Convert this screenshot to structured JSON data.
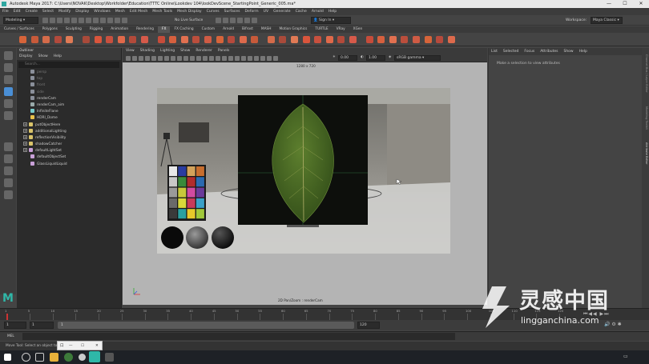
{
  "window": {
    "title": "Autodesk Maya 2017: C:\\Users\\NOVAK\\Desktop\\Workfolder\\Education\\TTTC Online\\Lookdev 104\\lookDevScene_StartingPoint_Generic_005.ma*",
    "controls": [
      "—",
      "☐",
      "✕"
    ]
  },
  "menubar": [
    "File",
    "Edit",
    "Create",
    "Select",
    "Modify",
    "Display",
    "Windows",
    "Mesh",
    "Edit Mesh",
    "Mesh Tools",
    "Mesh Display",
    "Curves",
    "Surfaces",
    "Deform",
    "UV",
    "Generate",
    "Cache",
    "Arnold",
    "Help"
  ],
  "statusline": {
    "mode": "Modeling",
    "live_surface": "No Live Surface",
    "sign_in": "Sign In",
    "workspace_label": "Workspace:",
    "workspace_value": "Maya Classic"
  },
  "shelf_tabs": [
    {
      "label": "Curves / Surfaces",
      "active": false
    },
    {
      "label": "Polygons",
      "active": false
    },
    {
      "label": "Sculpting",
      "active": false
    },
    {
      "label": "Rigging",
      "active": false
    },
    {
      "label": "Animation",
      "active": false
    },
    {
      "label": "Rendering",
      "active": false
    },
    {
      "label": "FX",
      "active": true
    },
    {
      "label": "FX Caching",
      "active": false
    },
    {
      "label": "Custom",
      "active": false
    },
    {
      "label": "Arnold",
      "active": false
    },
    {
      "label": "Bifrost",
      "active": false
    },
    {
      "label": "MASH",
      "active": false
    },
    {
      "label": "Motion Graphics",
      "active": false
    },
    {
      "label": "TURTLE",
      "active": false
    },
    {
      "label": "VRay",
      "active": false
    },
    {
      "label": "XGen",
      "active": false
    }
  ],
  "outliner": {
    "title": "Outliner",
    "menu": [
      "Display",
      "Show",
      "Help"
    ],
    "search_placeholder": "Search...",
    "items": [
      {
        "label": "persp",
        "dim": true,
        "icon": "camera-icon",
        "expander": false
      },
      {
        "label": "top",
        "dim": true,
        "icon": "camera-icon",
        "expander": false
      },
      {
        "label": "front",
        "dim": true,
        "icon": "camera-icon",
        "expander": false
      },
      {
        "label": "side",
        "dim": true,
        "icon": "camera-icon",
        "expander": false
      },
      {
        "label": "renderCam",
        "dim": false,
        "icon": "camera-icon",
        "expander": false
      },
      {
        "label": "renderCam_aim",
        "dim": false,
        "icon": "locator-icon",
        "expander": false
      },
      {
        "label": "InfiniteFlane",
        "dim": false,
        "icon": "mesh-icon",
        "expander": false
      },
      {
        "label": "HDRI_Dome",
        "dim": false,
        "icon": "light-icon",
        "expander": false
      },
      {
        "label": "putObjectHere",
        "dim": false,
        "icon": "group-icon",
        "expander": true
      },
      {
        "label": "additionalLighting",
        "dim": false,
        "icon": "group-icon",
        "expander": true
      },
      {
        "label": "reflectionVisibility",
        "dim": false,
        "icon": "group-icon",
        "expander": true
      },
      {
        "label": "shadowCatcher",
        "dim": false,
        "icon": "group-icon",
        "expander": true
      },
      {
        "label": "defaultLightSet",
        "dim": false,
        "icon": "set-icon",
        "expander": true
      },
      {
        "label": "defaultObjectSet",
        "dim": false,
        "icon": "set-icon",
        "expander": false
      },
      {
        "label": "GlassLiquidLiquid",
        "dim": false,
        "icon": "set-icon",
        "expander": false
      }
    ]
  },
  "viewport": {
    "menu": [
      "View",
      "Shading",
      "Lighting",
      "Show",
      "Renderer",
      "Panels"
    ],
    "exposure": "0.00",
    "gamma": "1.00",
    "color_space": "sRGB gamma",
    "resolution_hud": "1280 x 720",
    "camera_hud": "2D Pan/Zoom : renderCam"
  },
  "attribute_editor": {
    "menu": [
      "List",
      "Selected",
      "Focus",
      "Attributes",
      "Show",
      "Help"
    ],
    "message": "Make a selection to view attributes"
  },
  "side_tabs": [
    "Channel Box / Layer Editor",
    "Modeling Toolkit",
    "Attribute Editor"
  ],
  "timeline": {
    "ticks": [
      "1",
      "5",
      "10",
      "15",
      "20",
      "25",
      "30",
      "35",
      "40",
      "45",
      "50",
      "55",
      "60",
      "65",
      "70",
      "75",
      "80",
      "85",
      "90",
      "95",
      "100",
      "105",
      "110",
      "115",
      "120"
    ],
    "range_start": "1",
    "range_inner_start": "1",
    "range_marker": "1",
    "range_end": "120"
  },
  "command_line": {
    "label": "MEL"
  },
  "help_line": "Move Tool: Select an object to move.",
  "popup": {
    "title": "口",
    "controls": [
      "—",
      "☐",
      "✕"
    ]
  },
  "watermark": {
    "brand_cn": "灵感中国",
    "brand_url": "lingganchina.com"
  },
  "colors": {
    "maya_teal": "#2fb7a8",
    "accent_blue": "#4a8fd6",
    "active_tab": "#555555"
  }
}
